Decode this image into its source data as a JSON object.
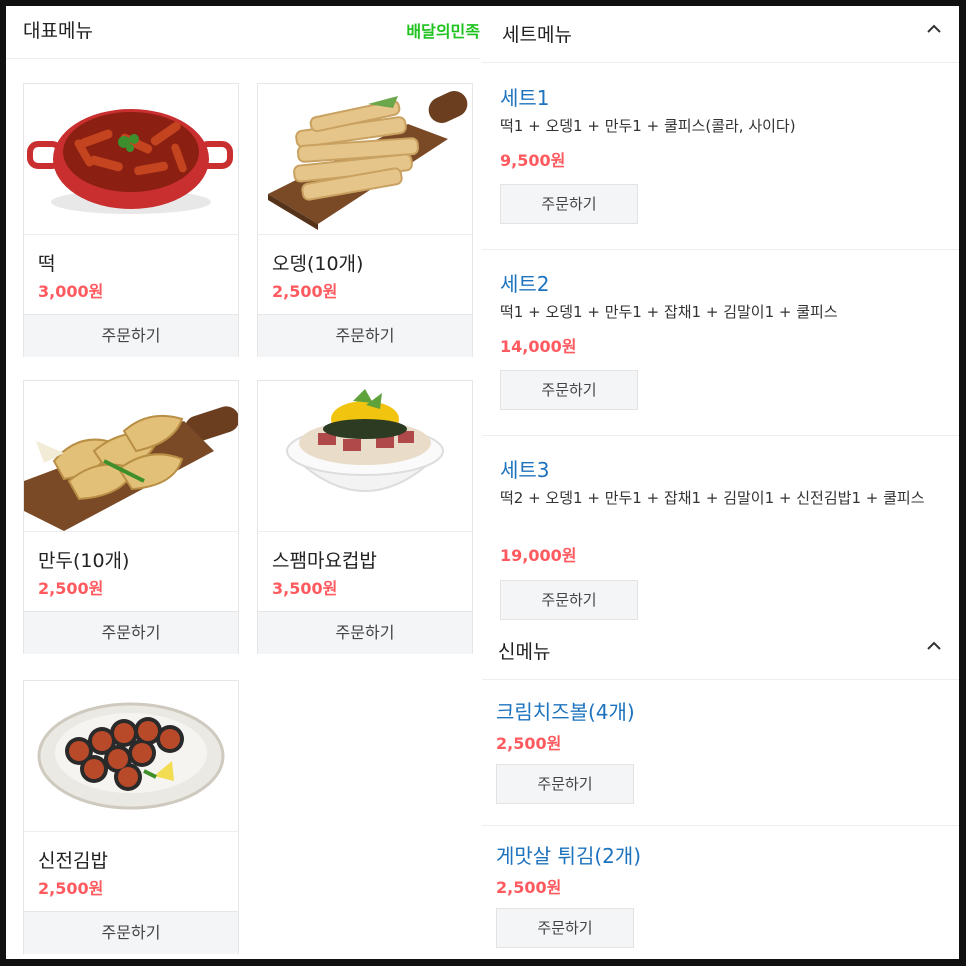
{
  "left": {
    "title": "대표메뉴",
    "brand": "배달의민족",
    "order_label": "주문하기",
    "cards": [
      {
        "name": "떡",
        "price": "3,000원",
        "icon": "tteokbokki-image"
      },
      {
        "name": "오뎅(10개)",
        "price": "2,500원",
        "icon": "odeng-image"
      },
      {
        "name": "만두(10개)",
        "price": "2,500원",
        "icon": "mandu-image"
      },
      {
        "name": "스팸마요컵밥",
        "price": "3,500원",
        "icon": "spam-mayo-cupbap-image"
      },
      {
        "name": "신전김밥",
        "price": "2,500원",
        "icon": "gimbap-image"
      }
    ]
  },
  "right": {
    "set_title": "세트메뉴",
    "new_title": "신메뉴",
    "order_label": "주문하기",
    "sets": [
      {
        "name": "세트1",
        "desc": "떡1 + 오뎅1 + 만두1 + 쿨피스(콜라, 사이다)",
        "price": "9,500원"
      },
      {
        "name": "세트2",
        "desc": "떡1 + 오뎅1 + 만두1 + 잡채1 + 김말이1 + 쿨피스",
        "price": "14,000원"
      },
      {
        "name": "세트3",
        "desc": "떡2 + 오뎅1 + 만두1 + 잡채1 + 김말이1 + 신전김밥1 + 쿨피스",
        "price": "19,000원"
      }
    ],
    "new_items": [
      {
        "name": "크림치즈볼(4개)",
        "price": "2,500원"
      },
      {
        "name": "게맛살 튀김(2개)",
        "price": "2,500원"
      }
    ]
  },
  "colors": {
    "price": "#ff5a5f",
    "link": "#1e73be",
    "brand": "#1fc21f"
  }
}
